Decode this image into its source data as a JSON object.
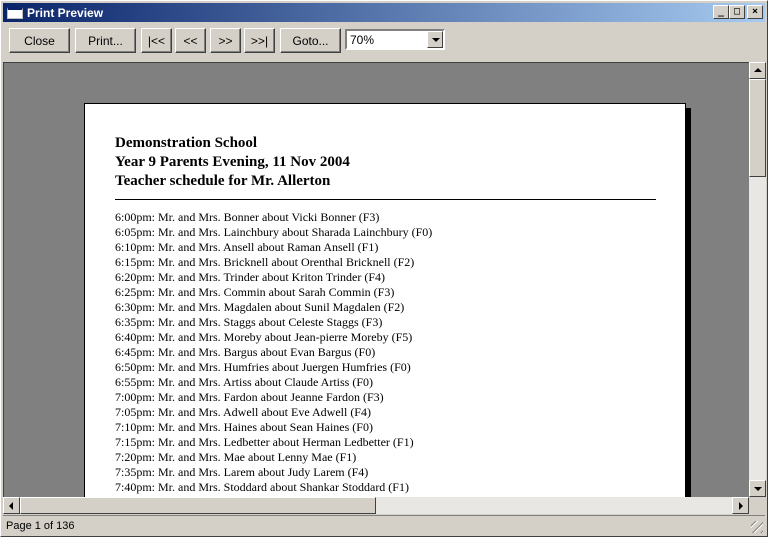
{
  "window": {
    "title": "Print Preview"
  },
  "toolbar": {
    "close": "Close",
    "print": "Print...",
    "first": "|<<",
    "prev": "<<",
    "next": ">>",
    "last": ">>|",
    "goto": "Goto...",
    "zoom": "70%"
  },
  "document": {
    "school": "Demonstration School",
    "event": "Year 9 Parents Evening, 11 Nov 2004",
    "schedule_title": "Teacher schedule for Mr. Allerton",
    "entries": [
      "6:00pm: Mr. and Mrs. Bonner about Vicki Bonner (F3)",
      "6:05pm: Mr. and Mrs. Lainchbury about Sharada Lainchbury (F0)",
      "6:10pm: Mr. and Mrs. Ansell about Raman Ansell (F1)",
      "6:15pm: Mr. and Mrs. Bricknell about Orenthal Bricknell (F2)",
      "6:20pm: Mr. and Mrs. Trinder about Kriton Trinder (F4)",
      "6:25pm: Mr. and Mrs. Commin about Sarah Commin (F3)",
      "6:30pm: Mr. and Mrs. Magdalen about Sunil Magdalen (F2)",
      "6:35pm: Mr. and Mrs. Staggs about Celeste Staggs (F3)",
      "6:40pm: Mr. and Mrs. Moreby about Jean-pierre Moreby (F5)",
      "6:45pm: Mr. and Mrs. Bargus about Evan Bargus (F0)",
      "6:50pm: Mr. and Mrs. Humfries about Juergen Humfries (F0)",
      "6:55pm: Mr. and Mrs. Artiss about Claude Artiss (F0)",
      "7:00pm: Mr. and Mrs. Fardon about Jeanne Fardon (F3)",
      "7:05pm: Mr. and Mrs. Adwell about Eve Adwell (F4)",
      "7:10pm: Mr. and Mrs. Haines about Sean Haines (F0)",
      "7:15pm: Mr. and Mrs. Ledbetter about Herman Ledbetter (F1)",
      "7:20pm: Mr. and Mrs. Mae about Lenny Mae (F1)",
      "7:35pm: Mr. and Mrs. Larem about Judy Larem (F4)",
      "7:40pm: Mr. and Mrs. Stoddard about Shankar Stoddard (F1)"
    ]
  },
  "status": {
    "page": "Page 1 of 136"
  },
  "colors": {
    "titlebar_start": "#0a246a",
    "titlebar_end": "#a6caf0",
    "workspace": "#808080",
    "chrome": "#d4d0c8"
  }
}
